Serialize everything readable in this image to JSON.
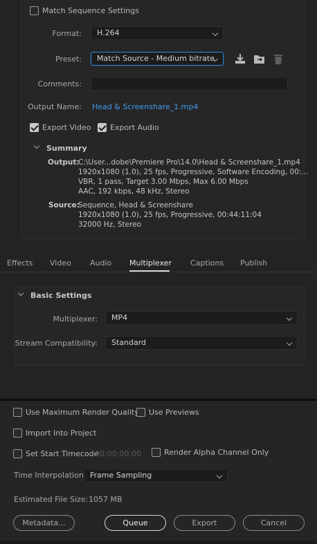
{
  "top": {
    "match_sequence_label": "Match Sequence Settings",
    "format_label": "Format:",
    "format_value": "H.264",
    "preset_label": "Preset:",
    "preset_value": "Match Source - Medium bitrate",
    "comments_label": "Comments:",
    "comments_value": "",
    "output_name_label": "Output Name:",
    "output_name_value": "Head & Screenshare_1.mp4",
    "export_video_label": "Export Video",
    "export_audio_label": "Export Audio",
    "summary_label": "Summary",
    "output_label": "Output:",
    "output_lines": [
      "C:\\User...dobe\\Premiere Pro\\14.0\\Head & Screenshare_1.mp4",
      "1920x1080 (1.0), 25 fps, Progressive, Software Encoding, 00:...",
      "VBR, 1 pass, Target 3.00 Mbps, Max 6.00 Mbps",
      "AAC, 192 kbps, 48 kHz, Stereo"
    ],
    "source_label": "Source:",
    "source_lines": [
      "Sequence, Head & Screenshare",
      "1920x1080 (1.0), 25 fps, Progressive, 00:44:11:04",
      "32000 Hz, Stereo"
    ]
  },
  "tabs": [
    "Effects",
    "Video",
    "Audio",
    "Multiplexer",
    "Captions",
    "Publish"
  ],
  "active_tab": "Multiplexer",
  "basic": {
    "title": "Basic Settings",
    "multiplexer_label": "Multiplexer:",
    "multiplexer_value": "MP4",
    "stream_label": "Stream Compatibility:",
    "stream_value": "Standard"
  },
  "bottom": {
    "max_render_label": "Use Maximum Render Quality",
    "use_previews_label": "Use Previews",
    "import_label": "Import Into Project",
    "start_timecode_label": "Set Start Timecode",
    "start_timecode_value": "00;00;00;00",
    "alpha_label": "Render Alpha Channel Only",
    "time_interp_label": "Time Interpolation:",
    "time_interp_value": "Frame Sampling",
    "file_size_label": "Estimated File Size:",
    "file_size_value": "1057 MB",
    "metadata_btn": "Metadata...",
    "queue_btn": "Queue",
    "export_btn": "Export",
    "cancel_btn": "Cancel"
  }
}
